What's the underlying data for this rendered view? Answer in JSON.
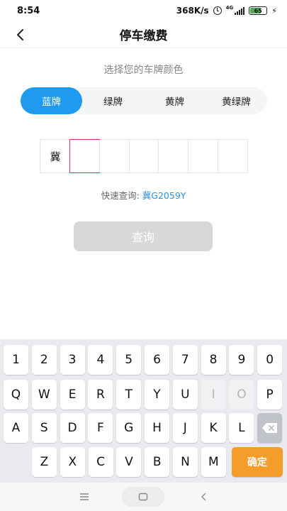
{
  "status_bar": {
    "time": "8:54",
    "speed": "368K/s",
    "network": "4G",
    "battery": "65",
    "battery_level": 0.65
  },
  "nav": {
    "title": "停车缴费"
  },
  "subtitle": "选择您的车牌颜色",
  "color_tabs": [
    {
      "label": "蓝牌",
      "active": true
    },
    {
      "label": "绿牌",
      "active": false
    },
    {
      "label": "黄牌",
      "active": false
    },
    {
      "label": "黄绿牌",
      "active": false
    }
  ],
  "plate": {
    "province": "冀",
    "chars": [
      "",
      "",
      "",
      "",
      "",
      ""
    ]
  },
  "quick_query": {
    "label": "快速查询:",
    "plate": "冀G2059Y"
  },
  "query_button": "查询",
  "keyboard": {
    "row1": [
      "1",
      "2",
      "3",
      "4",
      "5",
      "6",
      "7",
      "8",
      "9",
      "0"
    ],
    "row2": [
      "Q",
      "W",
      "E",
      "R",
      "T",
      "Y",
      "U",
      "I",
      "O",
      "P"
    ],
    "row2_disabled": [
      "I",
      "O"
    ],
    "row3": [
      "A",
      "S",
      "D",
      "F",
      "G",
      "H",
      "J",
      "K",
      "L"
    ],
    "row4": [
      "Z",
      "X",
      "C",
      "V",
      "B",
      "N",
      "M"
    ],
    "confirm": "确定"
  },
  "colors": {
    "accent": "#1e9bf0",
    "confirm": "#f59d2a",
    "link": "#2a8fe0",
    "cursor_border": "#d43a5a"
  }
}
